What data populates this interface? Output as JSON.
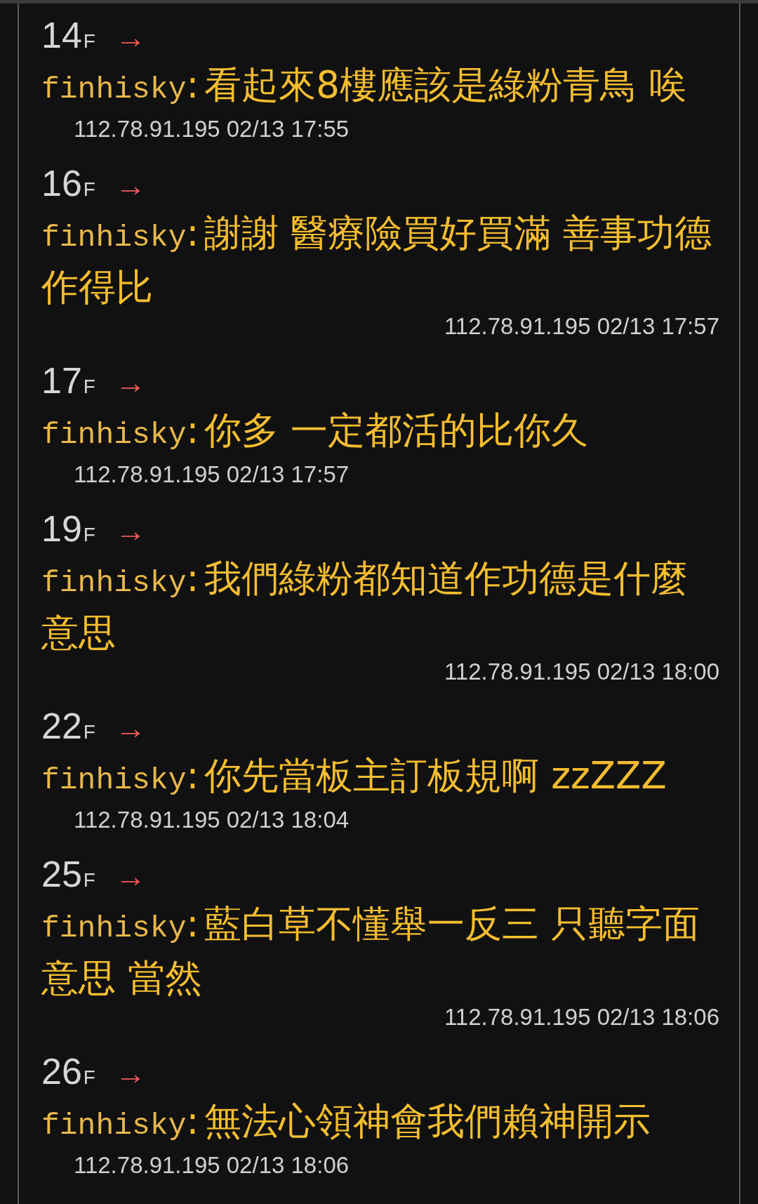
{
  "comments": [
    {
      "floor": "14",
      "floor_suffix": "F",
      "arrow": "→",
      "author": "finhisky",
      "separator": ":",
      "content": "看起來8樓應該是綠粉青鳥 唉",
      "meta": "112.78.91.195 02/13 17:55"
    },
    {
      "floor": "16",
      "floor_suffix": "F",
      "arrow": "→",
      "author": "finhisky",
      "separator": ":",
      "content": "謝謝 醫療險買好買滿 善事功德作得比",
      "meta": "112.78.91.195 02/13 17:57"
    },
    {
      "floor": "17",
      "floor_suffix": "F",
      "arrow": "→",
      "author": "finhisky",
      "separator": ":",
      "content": "你多 一定都活的比你久",
      "meta": "112.78.91.195 02/13 17:57"
    },
    {
      "floor": "19",
      "floor_suffix": "F",
      "arrow": "→",
      "author": "finhisky",
      "separator": ":",
      "content": "我們綠粉都知道作功德是什麼意思",
      "meta": "112.78.91.195 02/13 18:00"
    },
    {
      "floor": "22",
      "floor_suffix": "F",
      "arrow": "→",
      "author": "finhisky",
      "separator": ":",
      "content": "你先當板主訂板規啊 zzZZZ",
      "meta": "112.78.91.195 02/13 18:04"
    },
    {
      "floor": "25",
      "floor_suffix": "F",
      "arrow": "→",
      "author": "finhisky",
      "separator": ":",
      "content": "藍白草不懂舉一反三 只聽字面意思 當然",
      "meta": "112.78.91.195 02/13 18:06"
    },
    {
      "floor": "26",
      "floor_suffix": "F",
      "arrow": "→",
      "author": "finhisky",
      "separator": ":",
      "content": "無法心領神會我們賴神開示",
      "meta": "112.78.91.195 02/13 18:06"
    }
  ]
}
